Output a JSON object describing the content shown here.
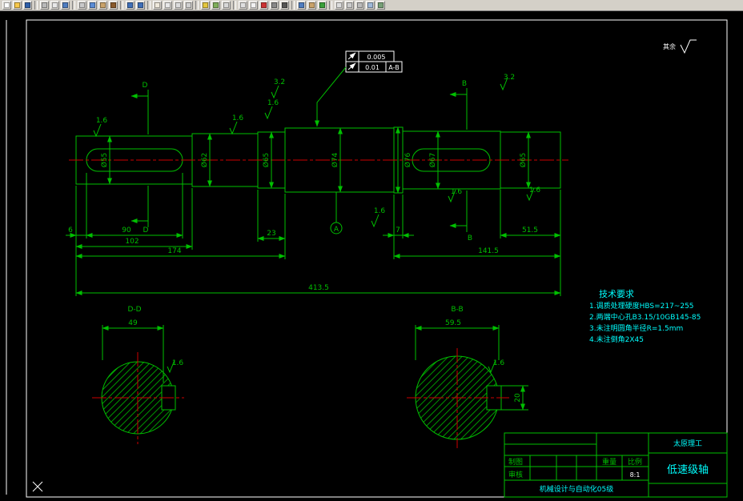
{
  "toolbar": {
    "icons": [
      {
        "name": "new",
        "c": "#ffffff"
      },
      {
        "name": "open",
        "c": "#f7c84b"
      },
      {
        "name": "save",
        "c": "#2f5fa8"
      },
      {
        "name": "separator"
      },
      {
        "name": "print",
        "c": "#b9b9b9"
      },
      {
        "name": "print-preview",
        "c": "#e8e8e8"
      },
      {
        "name": "spelling",
        "c": "#4f7dc0"
      },
      {
        "name": "separator"
      },
      {
        "name": "cut",
        "c": "#c9c9c9"
      },
      {
        "name": "copy",
        "c": "#5b8dd6"
      },
      {
        "name": "paste",
        "c": "#caa36a"
      },
      {
        "name": "match-properties",
        "c": "#8a5a2b"
      },
      {
        "name": "separator"
      },
      {
        "name": "undo",
        "c": "#3f6fb8"
      },
      {
        "name": "redo",
        "c": "#3f6fb8"
      },
      {
        "name": "separator"
      },
      {
        "name": "pan",
        "c": "#efe9dc"
      },
      {
        "name": "zoom-realtime",
        "c": "#e8e8e8"
      },
      {
        "name": "zoom-window",
        "c": "#dcdcdc"
      },
      {
        "name": "zoom-previous",
        "c": "#d0d0d0"
      },
      {
        "name": "separator"
      },
      {
        "name": "distance",
        "c": "#e3c63f"
      },
      {
        "name": "area",
        "c": "#7fae5a"
      },
      {
        "name": "list",
        "c": "#d8d8d8"
      },
      {
        "name": "separator"
      },
      {
        "name": "layers",
        "c": "#e0e0e0"
      },
      {
        "name": "layer-control",
        "c": "#f2f2f2"
      },
      {
        "name": "color-control",
        "c": "#cc3333"
      },
      {
        "name": "linetype",
        "c": "#888888"
      },
      {
        "name": "lineweight",
        "c": "#555555"
      },
      {
        "name": "separator"
      },
      {
        "name": "properties",
        "c": "#4f7dc0"
      },
      {
        "name": "designcenter",
        "c": "#caa36a"
      },
      {
        "name": "help",
        "c": "#3aa03a"
      },
      {
        "name": "separator"
      },
      {
        "name": "dimension",
        "c": "#dddddd"
      },
      {
        "name": "text",
        "c": "#cccccc"
      },
      {
        "name": "hatch",
        "c": "#bbbbbb"
      },
      {
        "name": "block",
        "c": "#9fb8d8"
      },
      {
        "name": "orbit",
        "c": "#77a077"
      }
    ]
  },
  "drawing": {
    "surplus": "其余",
    "runout1": {
      "val": "0.005"
    },
    "runout2": {
      "val": "0.01",
      "datum": "A-B"
    },
    "datum": "A",
    "diameters": [
      "Ø55",
      "Ø62",
      "Ø65",
      "Ø74",
      "Ø76",
      "Ø67",
      "Ø65"
    ],
    "lengths": [
      "6",
      "90",
      "102",
      "174",
      "23",
      "7",
      "51.5",
      "141.5",
      "413.5"
    ],
    "roughness": {
      "fine": "1.6",
      "medium": "3.2"
    },
    "sectionD": {
      "label": "D",
      "title": "D-D",
      "width": "49"
    },
    "sectionB": {
      "label": "B",
      "title": "B-B",
      "width": "59.5",
      "slot": "20"
    },
    "tech": {
      "title": "技术要求",
      "items": [
        "1.调质处理硬度HBS=217~255",
        "2.两端中心孔B3.15/10GB145-85",
        "3.未注明圆角半径R=1.5mm",
        "4.未注倒角2X45"
      ]
    },
    "titleblock": {
      "school": "太原理工",
      "part": "低速级轴",
      "course": "机械设计与自动化05级",
      "draw": "制图",
      "check": "审核",
      "weight": "重量",
      "scale": "比例",
      "scale_val": "8:1"
    }
  }
}
